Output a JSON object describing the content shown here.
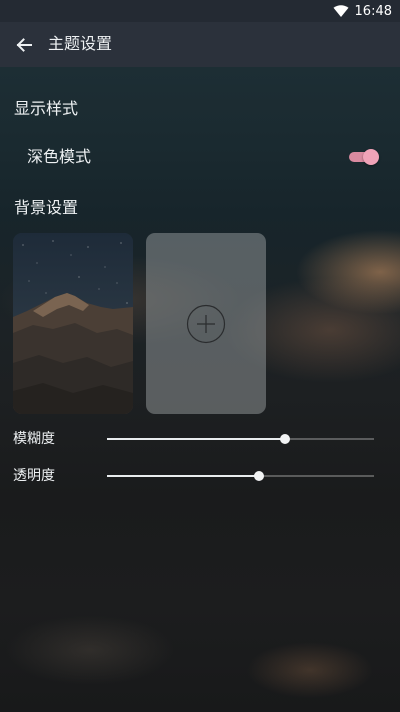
{
  "status_bar": {
    "time": "16:48",
    "icons": [
      "wifi-icon"
    ]
  },
  "app_bar": {
    "back_icon": "arrow-back-icon",
    "title": "主题设置"
  },
  "display_section": {
    "title": "显示样式",
    "dark_mode": {
      "label": "深色模式",
      "enabled": true,
      "accent_color": "#f0a3b8"
    }
  },
  "background_section": {
    "title": "背景设置",
    "thumbnails": [
      {
        "kind": "image",
        "description_icon": "mountain-image"
      },
      {
        "kind": "add",
        "icon": "plus-circle-icon"
      }
    ]
  },
  "sliders": [
    {
      "label": "模糊度",
      "level": 0.665
    },
    {
      "label": "透明度",
      "level": 0.57
    }
  ],
  "colors": {
    "app_bar": "#2b313b",
    "status_bar": "#242a33",
    "text": "#eef1f3"
  }
}
